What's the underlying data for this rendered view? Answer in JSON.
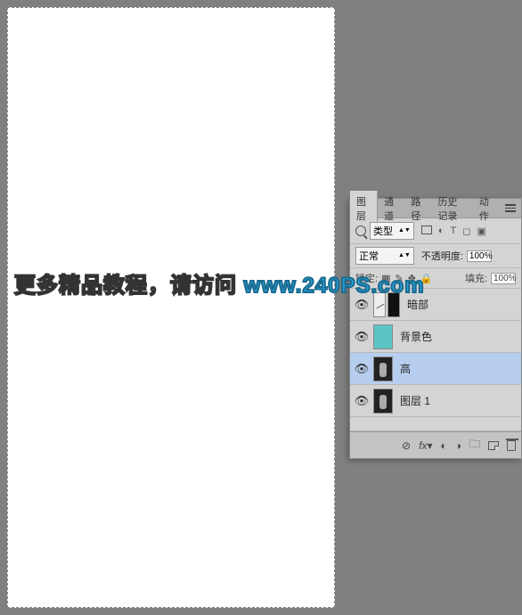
{
  "watermark": {
    "text": "更多精品教程，请访问 ",
    "url": "www.240PS.com"
  },
  "panel": {
    "tabs": [
      "图层",
      "通道",
      "路径",
      "历史记录",
      "动作"
    ],
    "active_tab": 0,
    "filter": {
      "type_label": "类型"
    },
    "blend_mode": "正常",
    "opacity_label": "不透明度:",
    "opacity_value": "100%",
    "lock_label": "锁定:",
    "fill_label": "填充:",
    "fill_value": "100%",
    "layers": [
      {
        "name": "暗部"
      },
      {
        "name": "背景色"
      },
      {
        "name": "高"
      },
      {
        "name": "图层 1"
      }
    ]
  }
}
